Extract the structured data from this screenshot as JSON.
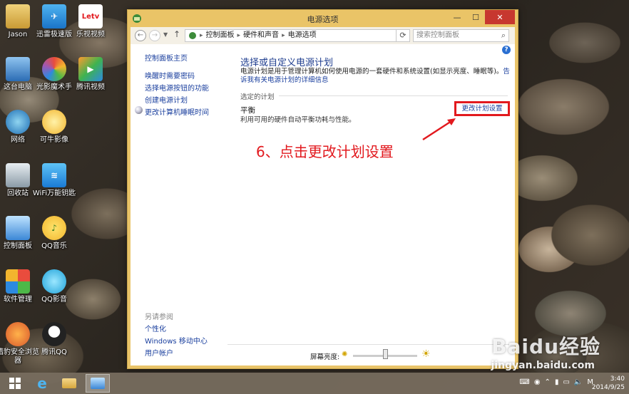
{
  "desktop": {
    "icons": [
      {
        "label": "Jason"
      },
      {
        "label": "迅雷极速版"
      },
      {
        "label": "乐视视频"
      },
      {
        "label": "这台电脑"
      },
      {
        "label": "光影魔术手"
      },
      {
        "label": "腾讯视频"
      },
      {
        "label": "网络"
      },
      {
        "label": "可牛影像"
      },
      {
        "label": "回收站"
      },
      {
        "label": "WiFi万能钥匙"
      },
      {
        "label": "控制面板"
      },
      {
        "label": "QQ音乐"
      },
      {
        "label": "软件管理"
      },
      {
        "label": "QQ影音"
      },
      {
        "label": "猎豹安全浏览器"
      },
      {
        "label": "腾讯QQ"
      }
    ]
  },
  "window": {
    "title": "电源选项",
    "breadcrumb": [
      "控制面板",
      "硬件和声音",
      "电源选项"
    ],
    "search_placeholder": "搜索控制面板",
    "sidebar": {
      "links": [
        "控制面板主页",
        "唤醒时需要密码",
        "选择电源按钮的功能",
        "创建电源计划",
        "更改计算机睡眠时间"
      ],
      "see_also_heading": "另请参阅",
      "see_also": [
        "个性化",
        "Windows 移动中心",
        "用户帐户"
      ]
    },
    "main": {
      "title": "选择或自定义电源计划",
      "description": "电源计划是用于管理计算机如何使用电源的一套硬件和系统设置(如显示亮度、睡眠等)。",
      "description_link": "告诉我有关电源计划的详细信息",
      "section_label": "选定的计划",
      "plan_name": "平衡",
      "plan_description": "利用可用的硬件自动平衡功耗与性能。",
      "change_plan_label": "更改计划设置"
    },
    "footer": {
      "brightness_label": "屏幕亮度:"
    }
  },
  "annotation": {
    "text": "6、点击更改计划设置",
    "color": "#e2191e"
  },
  "taskbar": {
    "ime_label": "M",
    "time": "3:40",
    "date": "2014/9/25"
  },
  "watermark": {
    "brand": "Baidu经验",
    "url": "jingyan.baidu.com"
  }
}
